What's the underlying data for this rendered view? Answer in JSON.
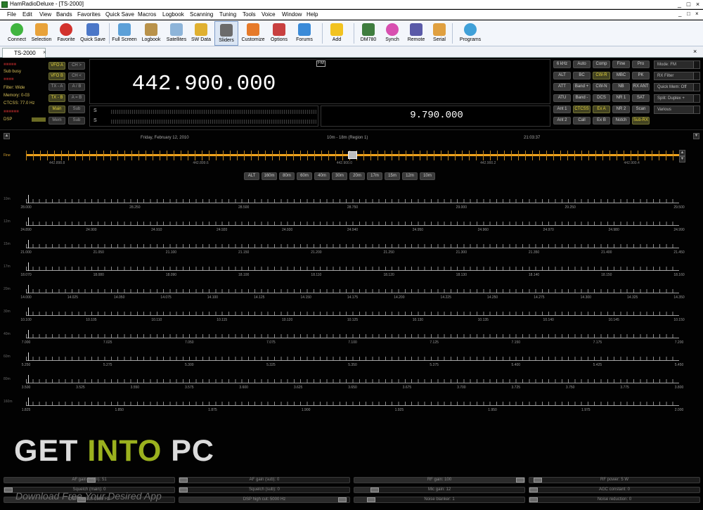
{
  "window": {
    "title": "HamRadioDeluxe - [TS-2000]",
    "controls": [
      "_",
      "□",
      "×"
    ]
  },
  "menu": {
    "items": [
      "File",
      "Edit",
      "View",
      "Bands",
      "Favorites",
      "Quick Save",
      "Macros",
      "Logbook",
      "Scanning",
      "Tuning",
      "Tools",
      "Voice",
      "Window",
      "Help"
    ],
    "window_controls": [
      "_",
      "□",
      "×"
    ]
  },
  "toolbar": {
    "buttons": [
      "Connect",
      "Selection",
      "Favorite",
      "Quick Save",
      "Full Screen",
      "Logbook",
      "Satellites",
      "SW Data",
      "Sliders",
      "Customize",
      "Options",
      "Forums",
      "Add",
      "DM780",
      "Synch",
      "Remote",
      "Serial",
      "Programs"
    ],
    "active": "Sliders"
  },
  "tab": {
    "label": "TS-2000",
    "close": "×",
    "right_close": "×"
  },
  "status": {
    "lines": [
      "Sub busy",
      "Filter: Wide",
      "Memory: 0-03",
      "CTCSS: 77.0 Hz",
      "DSP"
    ]
  },
  "vfo_buttons": [
    "VFO A",
    "CH >",
    "VFO B",
    "CH <",
    "TX - A",
    "A / B",
    "TX - B",
    "A = B",
    "Main",
    "Sub",
    "Mem",
    "Sub"
  ],
  "frequency": {
    "main": "442.900.000",
    "mode": "FM",
    "sub": "9.790.000"
  },
  "smeter": {
    "labels": [
      "S",
      "S"
    ]
  },
  "right_buttons": [
    [
      "6 kHz",
      "Auto",
      "Comp",
      "Fine",
      "Pro"
    ],
    [
      "ALT",
      "BC",
      "CW-R",
      "MBC",
      "PK"
    ],
    [
      "ATT",
      "Band +",
      "CW-N",
      "NB",
      "RX ANT"
    ],
    [
      "ATU",
      "Band -",
      "DCS",
      "NR 1",
      "SAT"
    ],
    [
      "Ant 1",
      "CTCSS",
      "Ex A",
      "NR 2",
      "Scan"
    ],
    [
      "Ant 2",
      "Call",
      "Ex B",
      "Notch",
      "Sub-RX"
    ]
  ],
  "dropdowns": [
    "Mode: FM",
    "RX Filter",
    "Quick Mem: Off",
    "Split: Duplex +",
    "Various"
  ],
  "info": {
    "date": "Friday, February 12, 2010",
    "band": "10m - 18m (Region 1)",
    "time": "21:03:37"
  },
  "fine_scale": {
    "label": "Fine",
    "ticks": [
      "442.898.8",
      "442.899.6",
      "442.900.0",
      "442.900.2",
      "442.900.4"
    ]
  },
  "band_selector": [
    "ALT",
    "160m",
    "80m",
    "60m",
    "40m",
    "30m",
    "20m",
    "17m",
    "15m",
    "12m",
    "10m"
  ],
  "band_scales": [
    {
      "label": "10m",
      "ticks": [
        "28.000",
        "28.250",
        "28.500",
        "28.750",
        "29.000",
        "29.250",
        "29.500"
      ]
    },
    {
      "label": "12m",
      "ticks": [
        "24.890",
        "24.900",
        "24.910",
        "24.920",
        "24.930",
        "24.940",
        "24.950",
        "24.960",
        "24.970",
        "24.980",
        "24.990"
      ]
    },
    {
      "label": "15m",
      "ticks": [
        "21.000",
        "21.050",
        "21.100",
        "21.150",
        "21.200",
        "21.250",
        "21.300",
        "21.350",
        "21.400",
        "21.450"
      ]
    },
    {
      "label": "17m",
      "ticks": [
        "18.070",
        "18.080",
        "18.090",
        "18.100",
        "18.110",
        "18.120",
        "18.130",
        "18.140",
        "18.150",
        "18.160"
      ]
    },
    {
      "label": "20m",
      "ticks": [
        "14.000",
        "14.025",
        "14.050",
        "14.075",
        "14.100",
        "14.125",
        "14.150",
        "14.175",
        "14.200",
        "14.225",
        "14.250",
        "14.275",
        "14.300",
        "14.325",
        "14.350"
      ]
    },
    {
      "label": "30m",
      "ticks": [
        "10.100",
        "10.105",
        "10.110",
        "10.115",
        "10.120",
        "10.125",
        "10.130",
        "10.135",
        "10.140",
        "10.145",
        "10.150"
      ]
    },
    {
      "label": "40m",
      "ticks": [
        "7.000",
        "7.025",
        "7.050",
        "7.075",
        "7.100",
        "7.125",
        "7.150",
        "7.175",
        "7.200"
      ]
    },
    {
      "label": "60m",
      "ticks": [
        "5.250",
        "5.275",
        "5.300",
        "5.325",
        "5.350",
        "5.375",
        "5.400",
        "5.425",
        "5.450"
      ]
    },
    {
      "label": "80m",
      "ticks": [
        "3.500",
        "3.525",
        "3.550",
        "3.575",
        "3.600",
        "3.625",
        "3.650",
        "3.675",
        "3.700",
        "3.725",
        "3.750",
        "3.775",
        "3.800"
      ]
    },
    {
      "label": "160m",
      "ticks": [
        "1.825",
        "1.850",
        "1.875",
        "1.900",
        "1.925",
        "1.950",
        "1.975",
        "2.000"
      ]
    }
  ],
  "sliders": [
    [
      "AF gain (main): 51",
      "AF gain (sub): 0",
      "RF gain: 100",
      "RF power: 5 W"
    ],
    [
      "Squelch (main): 0",
      "Squelch (sub): 0",
      "Mic gain: 12",
      "AGC constant: 0"
    ],
    [
      "DSP low cut: 1000 Hz",
      "DSP high cut: 5000 Hz",
      "Noise blanker: 1",
      "Noise reduction: 0"
    ]
  ],
  "slider_levels": [
    [
      0.51,
      0,
      1.0,
      0.05
    ],
    [
      0,
      0,
      0.12,
      0
    ],
    [
      0.45,
      0.95,
      0.1,
      0
    ]
  ],
  "watermark": {
    "a": "GET ",
    "b": "INTO ",
    "c": "PC",
    "sub": "Download Free Your Desired App"
  },
  "colors": {
    "accent": "#f0a31d",
    "status_red": "#c0392b"
  }
}
